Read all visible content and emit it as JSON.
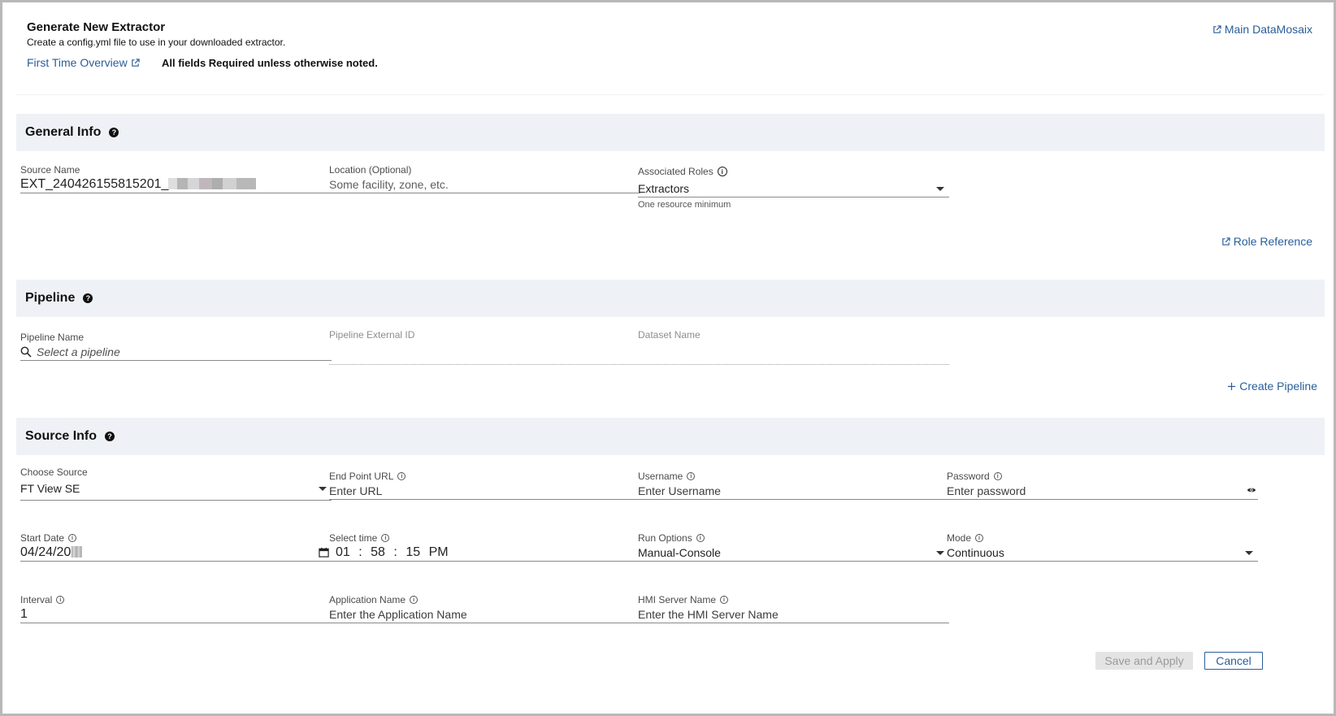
{
  "header": {
    "title": "Generate New Extractor",
    "subtitle": "Create a config.yml file to use in your downloaded extractor.",
    "first_time_link": "First Time Overview",
    "required_note": "All fields Required unless otherwise noted.",
    "main_link": "Main DataMosaix"
  },
  "general_info": {
    "title": "General Info",
    "source_name": {
      "label": "Source Name",
      "value": "EXT_240426155815201_"
    },
    "location": {
      "label": "Location (Optional)",
      "placeholder": "Some facility, zone, etc."
    },
    "roles": {
      "label": "Associated Roles",
      "value": "Extractors",
      "helper": "One resource minimum"
    },
    "role_reference_link": "Role Reference"
  },
  "pipeline": {
    "title": "Pipeline",
    "pipeline_name": {
      "label": "Pipeline Name",
      "placeholder": "Select a pipeline"
    },
    "external_id": {
      "label": "Pipeline External ID"
    },
    "dataset_name": {
      "label": "Dataset Name"
    },
    "create_link": "Create Pipeline"
  },
  "source_info": {
    "title": "Source Info",
    "choose_source": {
      "label": "Choose Source",
      "value": "FT View SE"
    },
    "endpoint_url": {
      "label": "End Point URL",
      "placeholder": "Enter URL"
    },
    "username": {
      "label": "Username",
      "placeholder": "Enter Username"
    },
    "password": {
      "label": "Password",
      "placeholder": "Enter password"
    },
    "start_date": {
      "label": "Start Date",
      "value": "04/24/20"
    },
    "select_time": {
      "label": "Select time",
      "hour": "01",
      "minute": "58",
      "second": "15",
      "ampm": "PM"
    },
    "run_options": {
      "label": "Run Options",
      "value": "Manual-Console"
    },
    "mode": {
      "label": "Mode",
      "value": "Continuous"
    },
    "interval": {
      "label": "Interval",
      "value": "1"
    },
    "application_name": {
      "label": "Application Name",
      "placeholder": "Enter the Application Name"
    },
    "hmi_server": {
      "label": "HMI Server Name",
      "placeholder": "Enter the HMI Server Name"
    }
  },
  "footer": {
    "save_label": "Save and Apply",
    "cancel_label": "Cancel"
  },
  "colors": {
    "accent": "#2a5e9a",
    "section_bg": "#eef2f6"
  },
  "icons": {
    "external": "external-link-icon",
    "help": "help-icon",
    "info": "info-icon",
    "search": "search-icon",
    "calendar": "calendar-icon",
    "eye": "eye-icon",
    "plus": "plus-icon"
  }
}
